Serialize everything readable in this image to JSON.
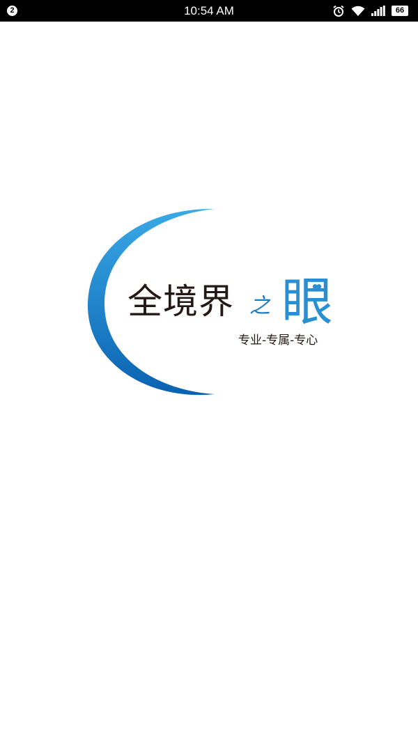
{
  "status_bar": {
    "notification_count": "2",
    "time": "10:54 AM",
    "battery_level": "66",
    "icons": [
      "alarm-icon",
      "wifi-icon",
      "signal-icon",
      "battery-icon"
    ]
  },
  "splash": {
    "title": "全境界",
    "title_connector": "之",
    "title_eye": "眼",
    "tagline": "专业-专属-专心",
    "colors": {
      "arc_light": "#3aa9e6",
      "arc_dark": "#0a62b0",
      "text_dark": "#231815",
      "eye_blue": "#2a8fd0"
    }
  }
}
